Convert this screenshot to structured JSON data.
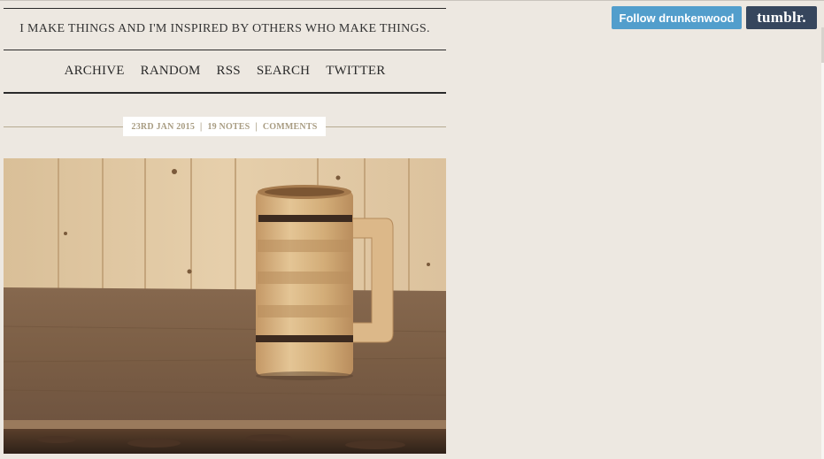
{
  "header": {
    "tagline": "I MAKE THINGS AND I'M INSPIRED BY OTHERS WHO MAKE THINGS."
  },
  "nav": {
    "items": [
      "ARCHIVE",
      "RANDOM",
      "RSS",
      "SEARCH",
      "TWITTER"
    ]
  },
  "post": {
    "date": "23RD JAN 2015",
    "notes": "19 NOTES",
    "comments": "COMMENTS",
    "separator": "|"
  },
  "tumblr_controls": {
    "follow_label": "Follow drunkenwood",
    "logo_label": "tumblr.",
    "follow_color": "#529ecc",
    "logo_color": "#36465d"
  },
  "colors": {
    "background": "#ede8e1",
    "meta_text": "#a89c82"
  }
}
